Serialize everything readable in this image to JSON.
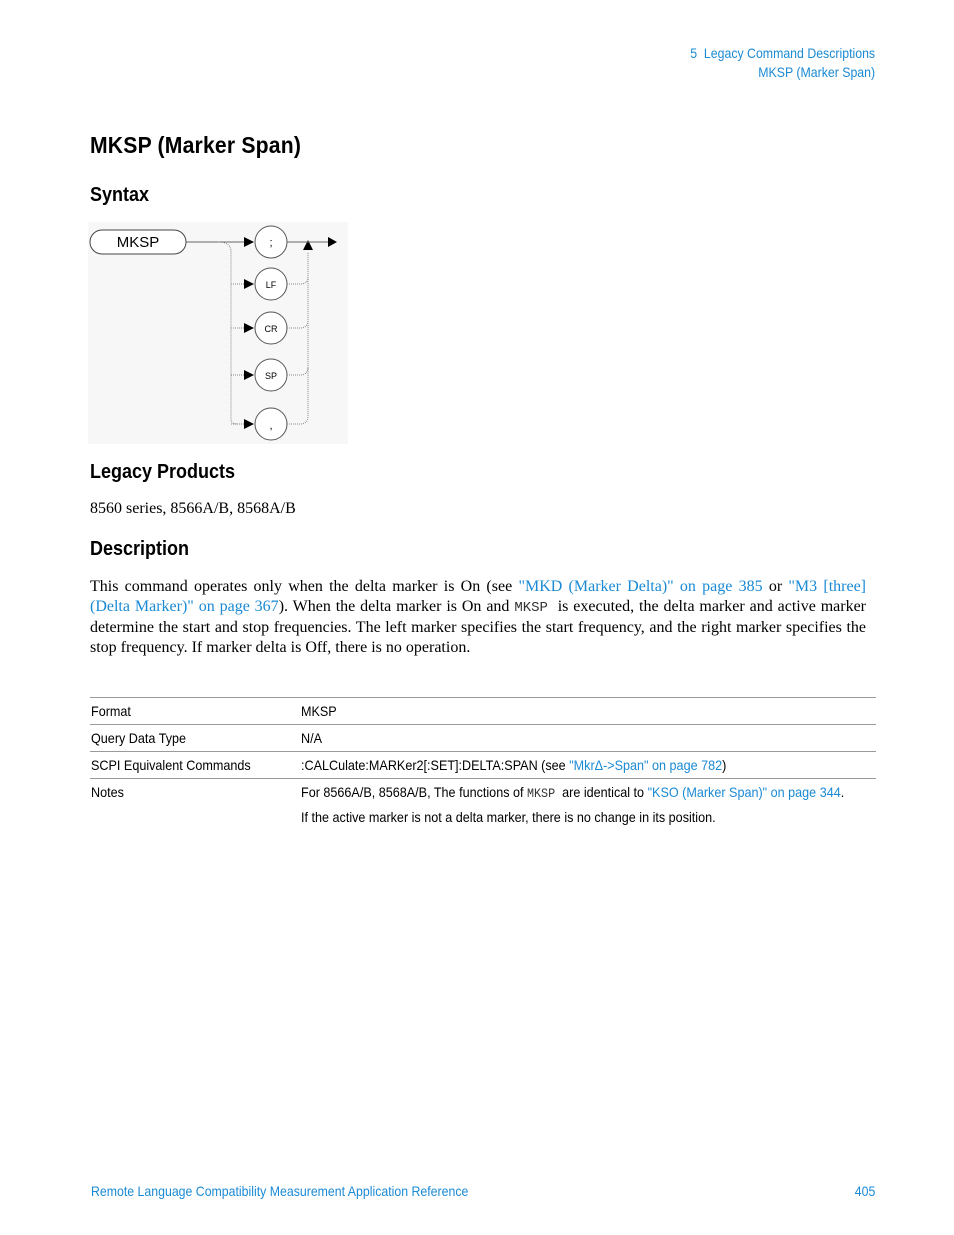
{
  "running_header": {
    "chapter": "5  Legacy Command Descriptions",
    "section": "MKSP (Marker Span)"
  },
  "page_title": "MKSP (Marker Span)",
  "syntax": {
    "heading": "Syntax",
    "diagram": {
      "command": "MKSP",
      "terminators": [
        ";",
        "LF",
        "CR",
        "SP",
        ","
      ]
    }
  },
  "legacy_products": {
    "heading": "Legacy Products",
    "text": "8560 series, 8566A/B, 8568A/B"
  },
  "description": {
    "heading": "Description",
    "t1": "This command operates only when the delta marker is On (see ",
    "link1": "\"MKD (Marker Delta)\" on page 385",
    "t2": " or ",
    "link2": "\"M3 [three] (Delta Marker)\" on page 367",
    "t3": "). When the delta marker is On and ",
    "code": "MKSP",
    "t4": "  is executed, the delta marker and active marker determine the start and stop frequencies. The left marker specifies the start frequency, and the right marker specifies the stop frequency. If marker delta is Off, there is no operation."
  },
  "table": {
    "rows": [
      {
        "key": "Format",
        "value": "MKSP"
      },
      {
        "key": "Query Data Type",
        "value": "N/A"
      },
      {
        "key": "SCPI Equivalent Commands",
        "value": ":CALCulate:MARKer2[:SET]:DELTA:SPAN (see ",
        "link": "\"MkrΔ->Span\" on page 782",
        "suffix": ")"
      },
      {
        "key": "Notes",
        "note1_pre": "For 8566A/B, 8568A/B, The functions of ",
        "note1_code": "MKSP",
        "note1_mid": "  are identical to ",
        "note1_link": "\"KSO (Marker Span)\" on page 344",
        "note1_post": ".",
        "note2": "If the active marker is not a delta marker, there is no change in its position."
      }
    ]
  },
  "footer": {
    "book_title": "Remote Language Compatibility Measurement Application Reference",
    "page_number": "405"
  }
}
